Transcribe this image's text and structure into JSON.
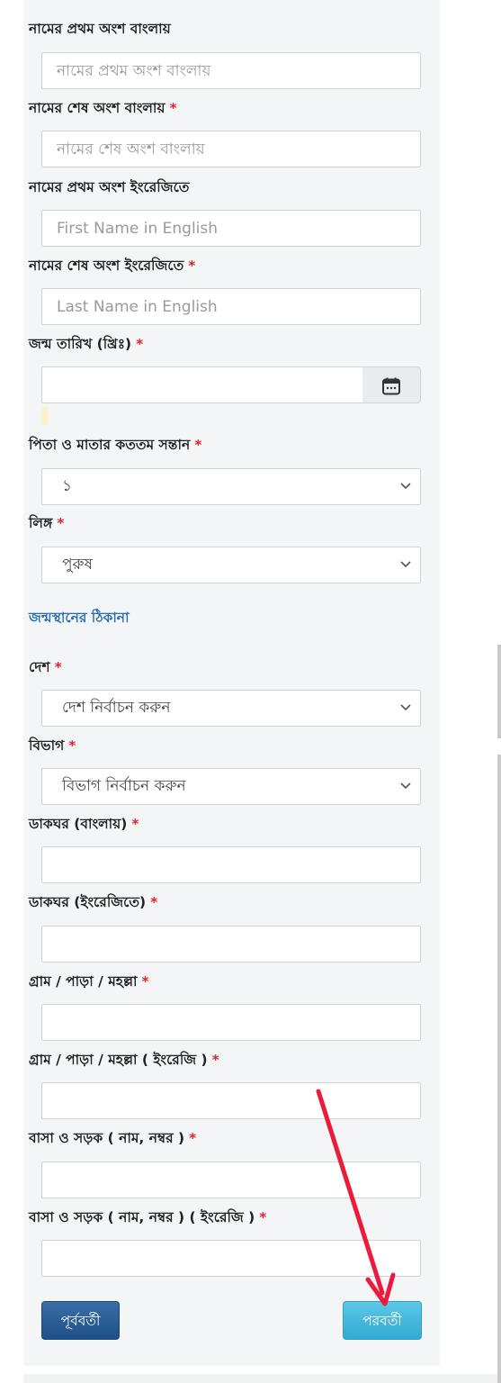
{
  "form": {
    "first_name_bn": {
      "label": "নামের প্রথম অংশ বাংলায়",
      "required": false,
      "placeholder": "নামের প্রথম অংশ বাংলায়",
      "value": ""
    },
    "last_name_bn": {
      "label": "নামের শেষ অংশ বাংলায়",
      "required": true,
      "placeholder": "নামের শেষ অংশ বাংলায়",
      "value": ""
    },
    "first_name_en": {
      "label": "নামের প্রথম অংশ ইংরেজিতে",
      "required": false,
      "placeholder": "First Name in English",
      "value": ""
    },
    "last_name_en": {
      "label": "নামের শেষ অংশ ইংরেজিতে",
      "required": true,
      "placeholder": "Last Name in English",
      "value": ""
    },
    "birth_date": {
      "label": "জন্ম তারিখ (খ্রিঃ)",
      "required": true,
      "value": ""
    },
    "child_order": {
      "label": "পিতা ও মাতার কততম সন্তান",
      "required": true,
      "selected": "১"
    },
    "gender": {
      "label": "লিঙ্গ",
      "required": true,
      "selected": "পুরুষ"
    },
    "birthplace_section": "জন্মস্থানের ঠিকানা",
    "country": {
      "label": "দেশ",
      "required": true,
      "selected": "দেশ নির্বাচন করুন"
    },
    "division": {
      "label": "বিভাগ",
      "required": true,
      "selected": "বিভাগ নির্বাচন করুন"
    },
    "post_office_bn": {
      "label": "ডাকঘর (বাংলায়)",
      "required": true,
      "value": ""
    },
    "post_office_en": {
      "label": "ডাকঘর (ইংরেজিতে)",
      "required": true,
      "value": ""
    },
    "village_bn": {
      "label": "গ্রাম / পাড়া / মহল্লা",
      "required": true,
      "value": ""
    },
    "village_en": {
      "label": "গ্রাম / পাড়া / মহল্লা ( ইংরেজি )",
      "required": true,
      "value": ""
    },
    "house_road_bn": {
      "label": "বাসা ও সড়ক ( নাম, নম্বর )",
      "required": true,
      "value": ""
    },
    "house_road_en": {
      "label": "বাসা ও সড়ক ( নাম, নম্বর ) ( ইংরেজি )",
      "required": true,
      "value": ""
    },
    "required_mark": "*"
  },
  "buttons": {
    "previous": "পূর্ববর্তী",
    "next": "পরবর্তী"
  },
  "colors": {
    "required": "#e3242b",
    "section_heading": "#2a6fb0",
    "previous_button": "#2a5d96",
    "next_button": "#45b8dd",
    "annotation_arrow": "#ec1b3b"
  },
  "icons": {
    "date_picker": "calendar-icon",
    "select": "chevron-down-icon",
    "annotation": "red-arrow"
  }
}
